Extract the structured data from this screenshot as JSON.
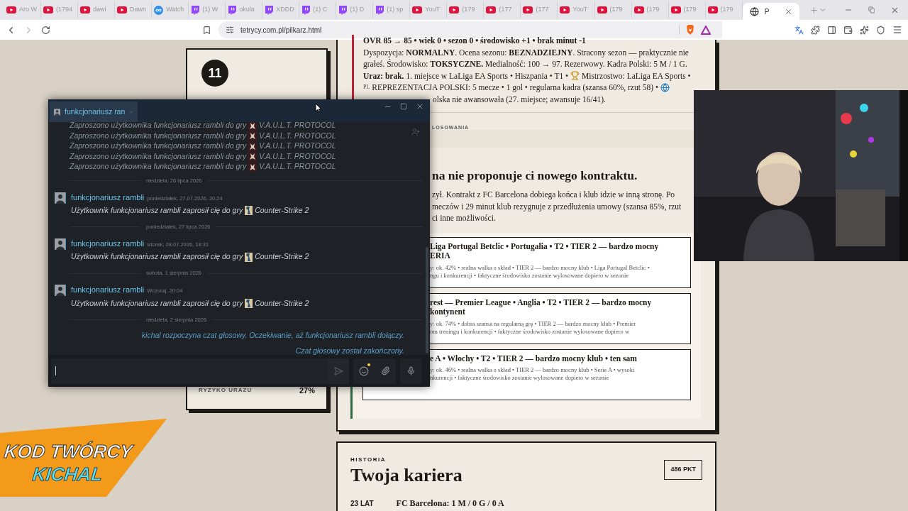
{
  "browser": {
    "tabs": [
      {
        "kind": "youtube",
        "title": "Aro W",
        "selected": false
      },
      {
        "kind": "youtube",
        "title": "(1794",
        "selected": false
      },
      {
        "kind": "youtube",
        "title": "dawi",
        "selected": false
      },
      {
        "kind": "youtube",
        "title": "Dawn",
        "selected": false
      },
      {
        "kind": "watch",
        "title": "Watch",
        "selected": false
      },
      {
        "kind": "twitch",
        "title": "(1) W",
        "selected": false
      },
      {
        "kind": "twitch",
        "title": "okula",
        "selected": false
      },
      {
        "kind": "twitch",
        "title": "XDDD",
        "selected": false
      },
      {
        "kind": "twitch",
        "title": "(1) C",
        "selected": false
      },
      {
        "kind": "twitch",
        "title": "(1) D",
        "selected": false
      },
      {
        "kind": "twitch",
        "title": "(1) sp",
        "selected": false
      },
      {
        "kind": "youtube",
        "title": "YouT",
        "selected": false
      },
      {
        "kind": "youtube",
        "title": "(179",
        "selected": false
      },
      {
        "kind": "youtube",
        "title": "(177",
        "selected": false
      },
      {
        "kind": "youtube",
        "title": "(177",
        "selected": false
      },
      {
        "kind": "youtube",
        "title": "YouT",
        "selected": false
      },
      {
        "kind": "youtube",
        "title": "(179",
        "selected": false
      },
      {
        "kind": "youtube",
        "title": "(179",
        "selected": false
      },
      {
        "kind": "youtube",
        "title": "(179",
        "selected": false
      },
      {
        "kind": "youtube",
        "title": "(179",
        "selected": false
      },
      {
        "kind": "globe",
        "title": "P",
        "selected": true
      }
    ],
    "address": "tetrycy.com.pl/pilkarz.html"
  },
  "player_card": {
    "badge": "11",
    "rows": [
      {
        "label": "RYZYKO URAZU",
        "value": "27%"
      }
    ]
  },
  "season_summary": {
    "headline": "OVR 85 → 85 • wiek 0 • sezon 0 • środowisko +1 • brak minut -1",
    "lines": [
      [
        {
          "kind": "text",
          "text": "Dyspozycja: **NORMALNY**. Ocena sezonu: **BEZNADZIEJNY**. Stracony sezon — praktycznie nie"
        }
      ],
      [
        {
          "kind": "text",
          "text": "grałeś. Środowisko: **TOKSYCZNE.** Medialność: 100 → 97. Rezerwowy. Kadra Polski: 5 M / 1 G."
        }
      ],
      [
        {
          "kind": "text",
          "text": "**Uraz: brak.** 1. miejsce w LaLiga EA Sports • Hiszpania • T1 •"
        },
        {
          "kind": "trophy"
        },
        {
          "kind": "text",
          "text": "Mistrzostwo: LaLiga EA Sports •"
        }
      ],
      [
        {
          "kind": "flag",
          "text": "PL"
        },
        {
          "kind": "text",
          "text": "REPREZENTACJA POLSKI: 5 mecze • 1 gol • regularna kadra (szansa 60%, rzut 58) •"
        },
        {
          "kind": "globe"
        }
      ]
    ],
    "tail": "olska nie awansowała (27. miejsce; awansuje 16/41)."
  },
  "draw_label": "LOSOWANIA",
  "contract": {
    "heading": "na nie proponuje ci nowego kontraktu.",
    "lines": [
      "zył. Kontrakt z FC Barcelona dobiega końca i klub idzie w inną stronę. Po",
      "meczów i 29 minut klub rezygnuje z przedłużenia umowy (szansa 85%, rzut",
      "ci inne możliwości."
    ]
  },
  "offers": [
    {
      "title_lines": [
        "Liga Portugal Betclic • Portugalia • T2 • TIER 2 — bardzo mocny",
        "ERIA"
      ],
      "detail_lines": [
        "y: ok. 42% • realna walka o skład • TIER 2 — bardzo mocny klub • Liga Portugal Betclic •",
        "ngu i konkurencji • faktyczne środowisko zostanie wylosowane dopiero w sezonie"
      ]
    },
    {
      "title_lines": [
        "rest — Premier League • Anglia • T2 • TIER 2 — bardzo mocny",
        "kontynent"
      ],
      "detail_lines": [
        "y: ok. 74% • dobra szansa na regularną grę • TIER 2 — bardzo mocny klub • Premier",
        "om treningu i konkurencji • faktyczne środowisko zostanie wylosowane dopiero w"
      ]
    },
    {
      "title_lines": [
        "e A • Włochy • T2 • TIER 2 — bardzo mocny klub • ten sam"
      ],
      "detail_lines": [
        "y: ok. 46% • realna walka o skład • TIER 2 — bardzo mocny klub • Serie A • wysoki",
        "nkurencji • faktyczne środowisko zostanie wylosowane dopiero w sezonie"
      ]
    }
  ],
  "history": {
    "eyebrow": "HISTORIA",
    "title": "Twoja kariera",
    "points": "486 PKT",
    "rows": [
      {
        "age": "23 LAT",
        "text": "FC Barcelona: 1 M / 0 G / 0 A"
      }
    ]
  },
  "chat": {
    "tab": "funkcjonariusz ran",
    "emoji_notification": true,
    "items": [
      {
        "kind": "system",
        "text": "Zaproszono użytkownika funkcjonariusz rambli do gry",
        "game": "V.A.U.L.T. PROTOCOL"
      },
      {
        "kind": "system",
        "text": "Zaproszono użytkownika funkcjonariusz rambli do gry",
        "game": "V.A.U.L.T. PROTOCOL"
      },
      {
        "kind": "system",
        "text": "Zaproszono użytkownika funkcjonariusz rambli do gry",
        "game": "V.A.U.L.T. PROTOCOL"
      },
      {
        "kind": "system",
        "text": "Zaproszono użytkownika funkcjonariusz rambli do gry",
        "game": "V.A.U.L.T. PROTOCOL"
      },
      {
        "kind": "system",
        "text": "Zaproszono użytkownika funkcjonariusz rambli do gry",
        "game": "V.A.U.L.T. PROTOCOL"
      },
      {
        "kind": "divider",
        "text": "niedziela, 26 lipca 2026"
      },
      {
        "kind": "message",
        "author": "funkcjonariusz rambli",
        "time": "poniedziałek, 27.07.2026, 20:24",
        "text": "Użytkownik funkcjonariusz rambli zaprosił cię do gry",
        "game": "Counter-Strike 2"
      },
      {
        "kind": "divider",
        "text": "poniedziałek, 27 lipca 2026"
      },
      {
        "kind": "message",
        "author": "funkcjonariusz rambli",
        "time": "wtorek, 28.07.2026, 18:31",
        "text": "Użytkownik funkcjonariusz rambli zaprosił cię do gry",
        "game": "Counter-Strike 2"
      },
      {
        "kind": "divider",
        "text": "sobota, 1 sierpnia 2026"
      },
      {
        "kind": "message",
        "author": "funkcjonariusz rambli",
        "time": "Wczoraj, 20:04",
        "text": "Użytkownik funkcjonariusz rambli zaprosił cię do gry",
        "game": "Counter-Strike 2"
      },
      {
        "kind": "divider",
        "text": "niedziela, 2 sierpnia 2026"
      },
      {
        "kind": "voice",
        "text": "kichal rozpoczyna czat głosowy. Oczekiwanie, aż funkcjonariusz rambli dołączy."
      },
      {
        "kind": "voice",
        "text": "Czat głosowy został zakończony."
      }
    ]
  },
  "creator_code": {
    "label": "KOD TWÓRCY",
    "code": "KICHAL"
  }
}
